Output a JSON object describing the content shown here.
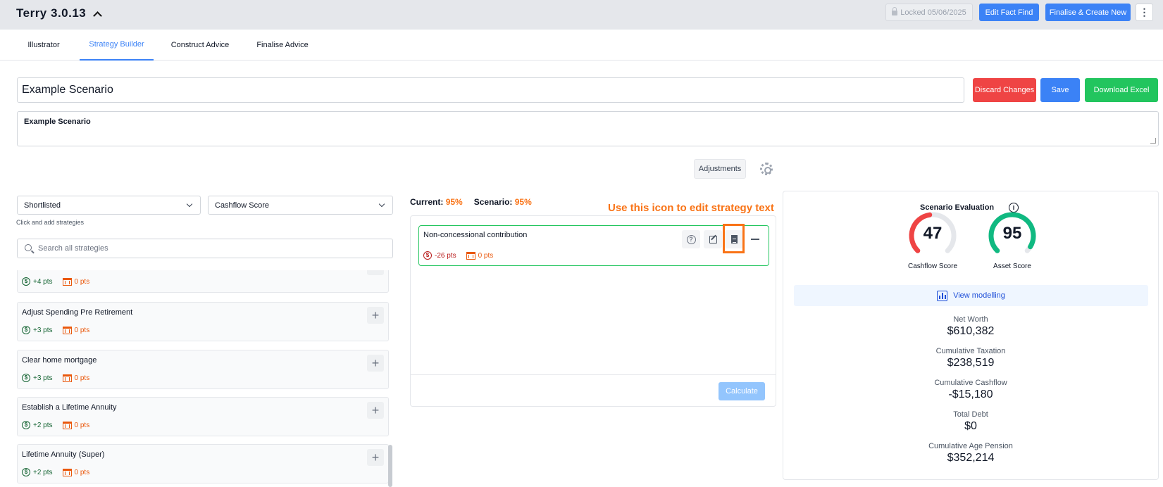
{
  "header": {
    "title": "Terry 3.0.13",
    "locked_label": "Locked 05/06/2025",
    "edit_fact_find_label": "Edit Fact Find",
    "finalise_label": "Finalise & Create New",
    "kebab_label": "⋮"
  },
  "tabs": [
    {
      "label": "Illustrator",
      "active": false
    },
    {
      "label": "Strategy Builder",
      "active": true
    },
    {
      "label": "Construct Advice",
      "active": false
    },
    {
      "label": "Finalise Advice",
      "active": false
    }
  ],
  "scenario": {
    "name": "Example Scenario",
    "description": "Example Scenario",
    "discard_label": "Discard Changes",
    "save_label": "Save",
    "download_label": "Download Excel",
    "adjustments_label": "Adjustments"
  },
  "filters": {
    "list_select": "Shortlisted",
    "sort_select": "Cashflow Score",
    "hint": "Click and add strategies",
    "search_placeholder": "Search all strategies"
  },
  "strategies": [
    {
      "title": "",
      "cashflow_pts": "+4 pts",
      "asset_pts": "0 pts"
    },
    {
      "title": "Adjust Spending Pre Retirement",
      "cashflow_pts": "+3 pts",
      "asset_pts": "0 pts"
    },
    {
      "title": "Clear home mortgage",
      "cashflow_pts": "+3 pts",
      "asset_pts": "0 pts"
    },
    {
      "title": "Establish a Lifetime Annuity",
      "cashflow_pts": "+2 pts",
      "asset_pts": "0 pts"
    },
    {
      "title": "Lifetime Annuity (Super)",
      "cashflow_pts": "+2 pts",
      "asset_pts": "0 pts"
    }
  ],
  "comparison": {
    "current_label": "Current:",
    "current_value": "95%",
    "scenario_label": "Scenario:",
    "scenario_value": "95%"
  },
  "annotation": "Use this icon to edit strategy text",
  "selected_strategy": {
    "title": "Non-concessional contribution",
    "cashflow_pts": "-26 pts",
    "asset_pts": "0 pts",
    "help_glyph": "?"
  },
  "calculate_label": "Calculate",
  "evaluation": {
    "title": "Scenario Evaluation",
    "info_glyph": "i",
    "cashflow_score": "47",
    "cashflow_label": "Cashflow Score",
    "cashflow_fraction": 0.47,
    "cashflow_color": "#ef4444",
    "asset_score": "95",
    "asset_label": "Asset Score",
    "asset_fraction": 0.95,
    "asset_color": "#10b981",
    "view_modelling_label": "View modelling",
    "metrics": [
      {
        "label": "Net Worth",
        "value": "$610,382"
      },
      {
        "label": "Cumulative Taxation",
        "value": "$238,519"
      },
      {
        "label": "Cumulative Cashflow",
        "value": "-$15,180"
      },
      {
        "label": "Total Debt",
        "value": "$0"
      },
      {
        "label": "Cumulative Age Pension",
        "value": "$352,214"
      }
    ]
  }
}
